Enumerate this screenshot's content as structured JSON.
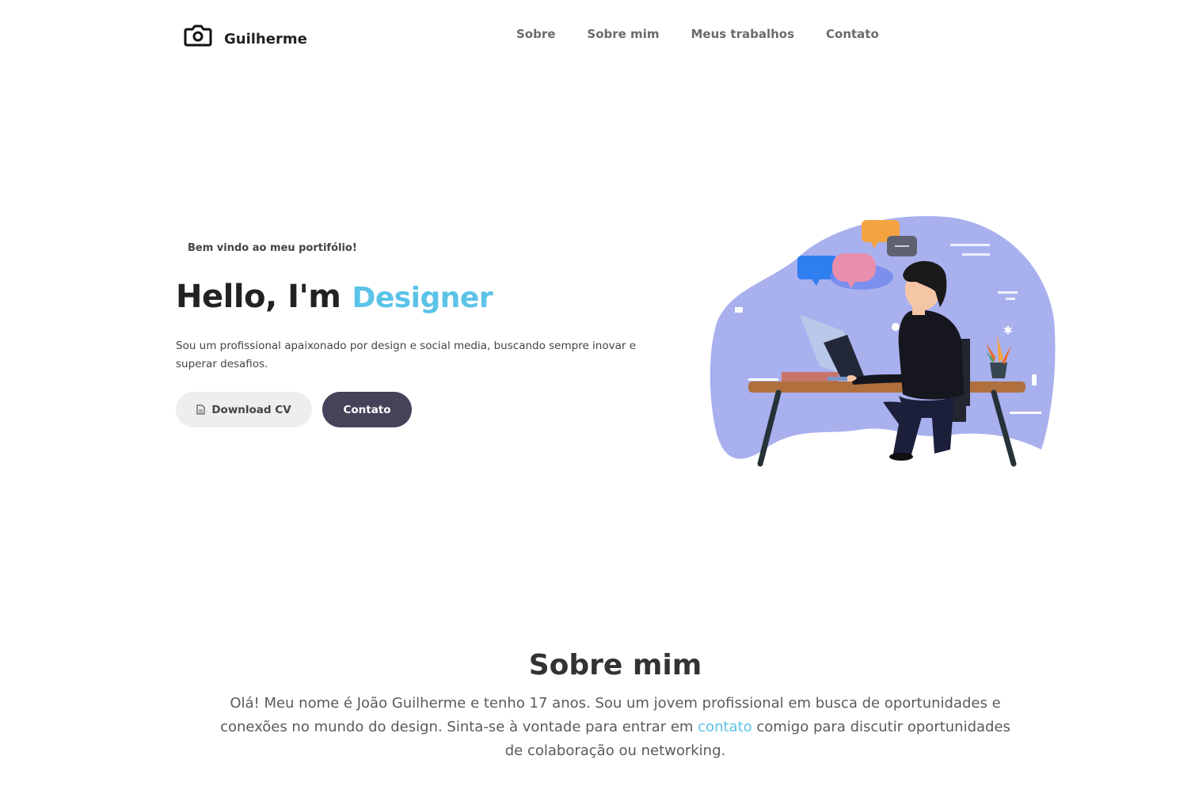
{
  "header": {
    "logo_icon": "camera-icon",
    "brand": "Guilherme",
    "nav": [
      {
        "label": "Sobre"
      },
      {
        "label": "Sobre mim"
      },
      {
        "label": "Meus trabalhos"
      },
      {
        "label": "Contato"
      }
    ]
  },
  "hero": {
    "welcome": "Bem vindo ao meu portifólio!",
    "greeting": "Hello, I'm",
    "role": "Designer",
    "description": "Sou um profissional apaixonado por design e social media, buscando sempre inovar e superar desafios.",
    "download_label": "Download CV",
    "download_icon": "document-icon",
    "contact_label": "Contato",
    "illustration": "person-at-desk-illustration"
  },
  "about": {
    "title": "Sobre mim",
    "text_before": "Olá! Meu nome é João Guilherme e tenho 17 anos. Sou um jovem profissional em busca de oportunidades e conexões no mundo do design. Sinta-se à vontade para entrar em ",
    "link_label": "contato",
    "text_after": " comigo para discutir oportunidades de colaboração ou networking."
  },
  "colors": {
    "accent": "#5bc3e8",
    "dark_button": "#47415a",
    "light_button": "#eeeeee",
    "blob": "#a9b0ee"
  }
}
